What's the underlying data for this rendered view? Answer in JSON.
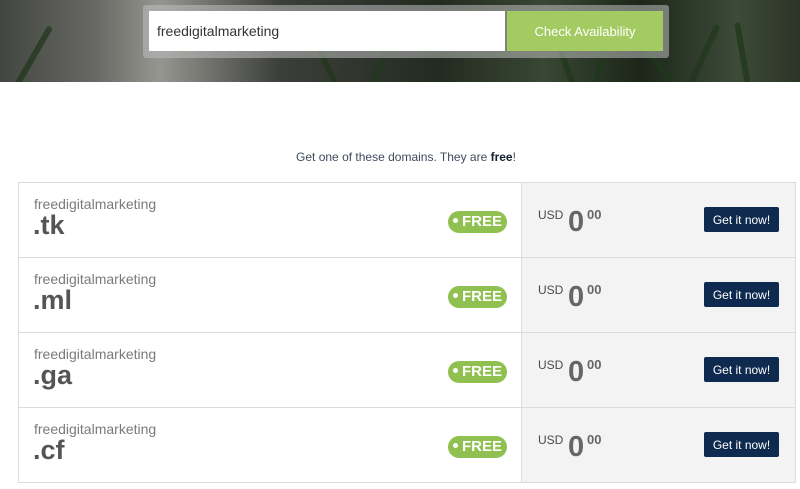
{
  "search": {
    "value": "freedigitalmarketing",
    "button_label": "Check Availability"
  },
  "tagline": {
    "prefix": "Get one of these domains. They are ",
    "emphasis": "free",
    "suffix": "!"
  },
  "results": [
    {
      "name": "freedigitalmarketing",
      "tld": ".tk",
      "badge": "FREE",
      "currency": "USD",
      "price_main": "0",
      "price_cents": "00",
      "button": "Get it now!"
    },
    {
      "name": "freedigitalmarketing",
      "tld": ".ml",
      "badge": "FREE",
      "currency": "USD",
      "price_main": "0",
      "price_cents": "00",
      "button": "Get it now!"
    },
    {
      "name": "freedigitalmarketing",
      "tld": ".ga",
      "badge": "FREE",
      "currency": "USD",
      "price_main": "0",
      "price_cents": "00",
      "button": "Get it now!"
    },
    {
      "name": "freedigitalmarketing",
      "tld": ".cf",
      "badge": "FREE",
      "currency": "USD",
      "price_main": "0",
      "price_cents": "00",
      "button": "Get it now!"
    }
  ],
  "colors": {
    "check_button": "#a4cb62",
    "free_badge": "#8fc050",
    "get_button": "#0e2a4e"
  }
}
